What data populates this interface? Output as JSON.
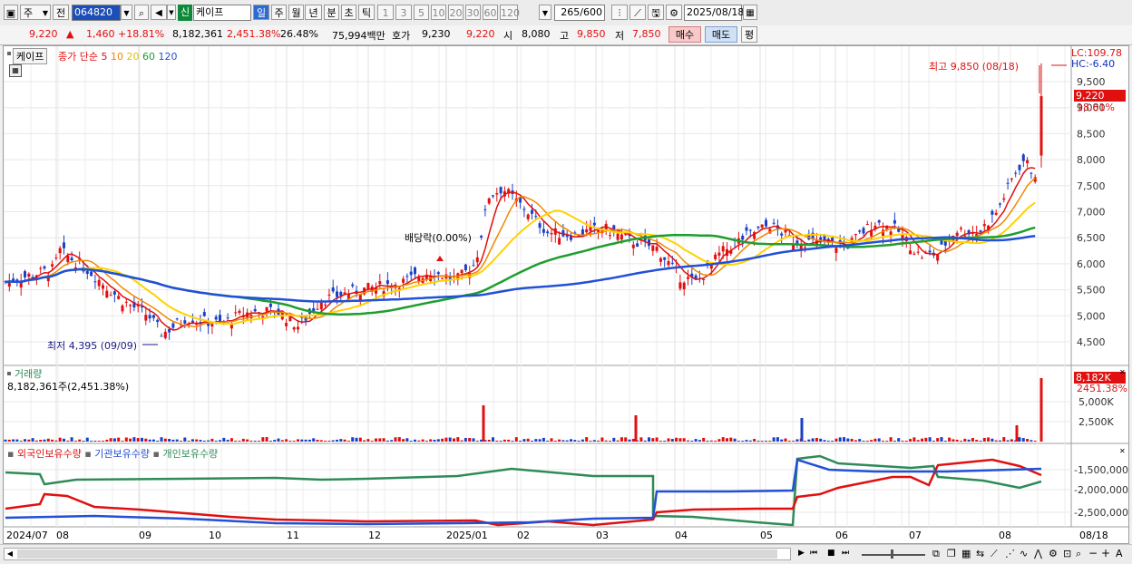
{
  "toolbar": {
    "type_select": "주",
    "prev_label": "전",
    "code": "064820",
    "market_badge": "신",
    "stock_name": "케이프",
    "periods": [
      "일",
      "주",
      "월",
      "년",
      "분",
      "초",
      "틱"
    ],
    "numbers": [
      "1",
      "3",
      "5",
      "10",
      "20",
      "30",
      "60",
      "120"
    ],
    "count": "265",
    "count_max": "/600",
    "date": "2025/08/18"
  },
  "info": {
    "price": "9,220",
    "change": "1,460",
    "change_pct": "+18.81%",
    "volume": "8,182,361",
    "vol_ratio": "2,451.38%",
    "turnover": "26.48%",
    "amount": "75,994백만",
    "quote_label": "호가",
    "quote1": "9,230",
    "quote2": "9,220",
    "open_label": "시",
    "open": "8,080",
    "high_label": "고",
    "high": "9,850",
    "low_label": "저",
    "low": "7,850",
    "buy": "매수",
    "sell": "매도",
    "avg": "평"
  },
  "price_panel": {
    "stock_tag": "케이프",
    "ma_prefix": "종가 단순",
    "ma_periods": [
      "5",
      "10",
      "20",
      "60",
      "120"
    ],
    "ma_colors": [
      "#e01010",
      "#f08a00",
      "#ffd200",
      "#1e9e2e",
      "#2250d6"
    ],
    "lc_label": "LC:109.78",
    "hc_label": "HC:-6.40",
    "high_note": "최고 9,850 (08/18)",
    "low_note": "최저 4,395 (09/09)",
    "dividend_note": "배당락(0.00%)",
    "current_tag": "9,220",
    "current_pct": "18.81%",
    "y_labels": [
      "9,500",
      "9,000",
      "8,500",
      "8,000",
      "7,500",
      "7,000",
      "6,500",
      "6,000",
      "5,500",
      "5,000",
      "4,500"
    ]
  },
  "volume_panel": {
    "title": "거래량",
    "value": "8,182,361주(2,451.38%)",
    "tag": "8,182K",
    "tag_pct": "2451.38%",
    "y_labels": [
      "5,000K",
      "2,500K"
    ]
  },
  "holding_panel": {
    "legend": [
      "외국인보유수량",
      "기관보유수량",
      "개인보유수량"
    ],
    "legend_colors": [
      "#e01010",
      "#2250d6",
      "#2e8b57"
    ],
    "y_labels": [
      "-1,500,000",
      "-2,000,000",
      "-2,500,000"
    ]
  },
  "x_axis": {
    "labels": [
      "2024/07",
      "08",
      "09",
      "10",
      "11",
      "12",
      "2025/01",
      "02",
      "03",
      "04",
      "05",
      "06",
      "07",
      "08"
    ],
    "right_label": "08/18"
  },
  "chart_data": {
    "type": "candlestick",
    "y_price_range": [
      4250,
      9850
    ],
    "ma_periods": [
      5,
      10,
      20,
      60,
      120
    ],
    "month_labels": [
      "2024/07",
      "08",
      "09",
      "10",
      "11",
      "12",
      "2025/01",
      "02",
      "03",
      "04",
      "05",
      "06",
      "07",
      "08"
    ],
    "last_close": 9220,
    "period_high": 9850,
    "period_low": 4395,
    "volume_unit": "K",
    "last_volume_k": 8182
  }
}
